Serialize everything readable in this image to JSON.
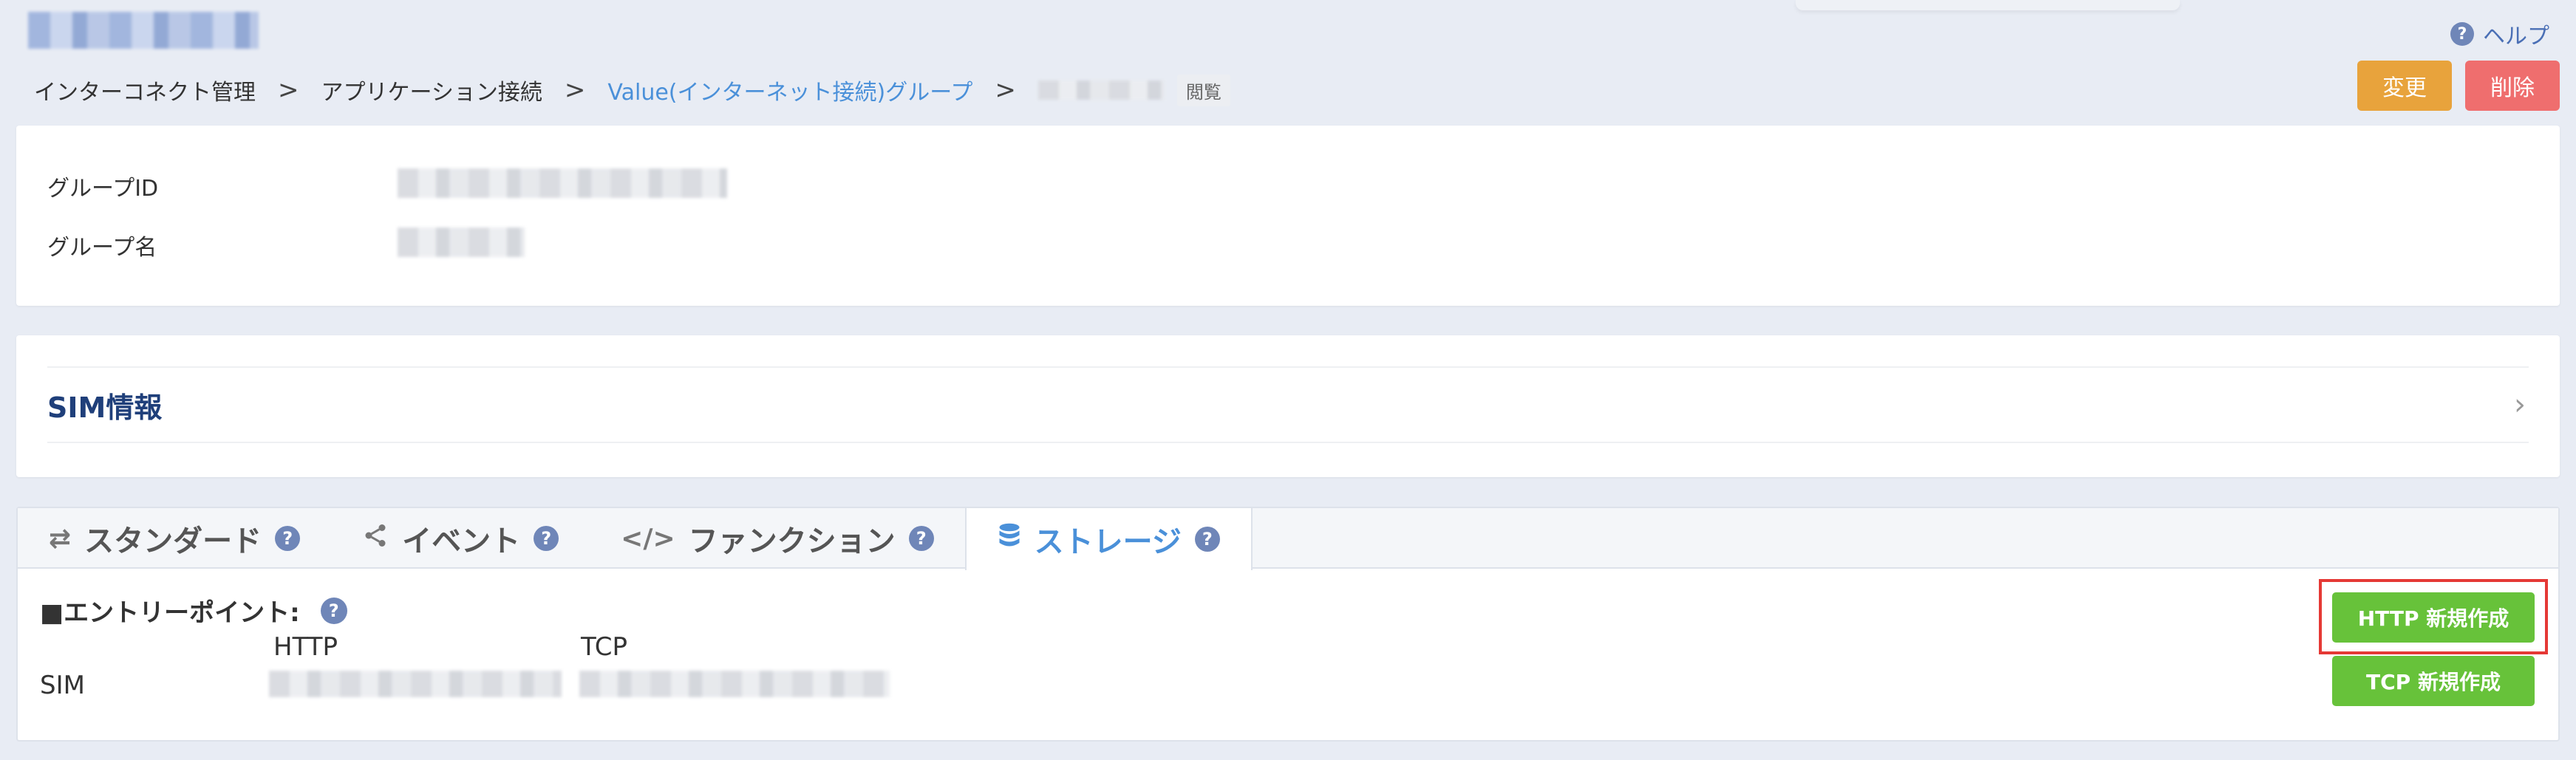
{
  "header": {
    "help_label": "ヘルプ",
    "help_icon": "question-circle-icon"
  },
  "breadcrumb": {
    "items": [
      "インターコネクト管理",
      "アプリケーション接続",
      "Value(インターネット接続)グループ"
    ],
    "mode_badge": "閲覧"
  },
  "actions": {
    "edit_label": "変更",
    "delete_label": "削除"
  },
  "group_info": {
    "id_label": "グループID",
    "name_label": "グループ名"
  },
  "sim_section": {
    "title": "SIM情報"
  },
  "tabs": [
    {
      "label": "スタンダード",
      "icon": "arrows-exchange-icon",
      "active": false
    },
    {
      "label": "イベント",
      "icon": "share-icon",
      "active": false
    },
    {
      "label": "ファンクション",
      "icon": "code-icon",
      "active": false
    },
    {
      "label": "ストレージ",
      "icon": "database-icon",
      "active": true
    }
  ],
  "storage": {
    "entry_title": "■エントリーポイント:",
    "col_http": "HTTP",
    "col_tcp": "TCP",
    "row_label": "SIM",
    "http_new_label": "HTTP 新規作成",
    "tcp_new_label": "TCP 新規作成"
  },
  "colors": {
    "background": "#e8ecf4",
    "accent_blue": "#4a90d9",
    "edit_orange": "#e8a33c",
    "delete_red": "#ef6e6e",
    "create_green": "#67c23a",
    "highlight_red": "#e53935"
  }
}
